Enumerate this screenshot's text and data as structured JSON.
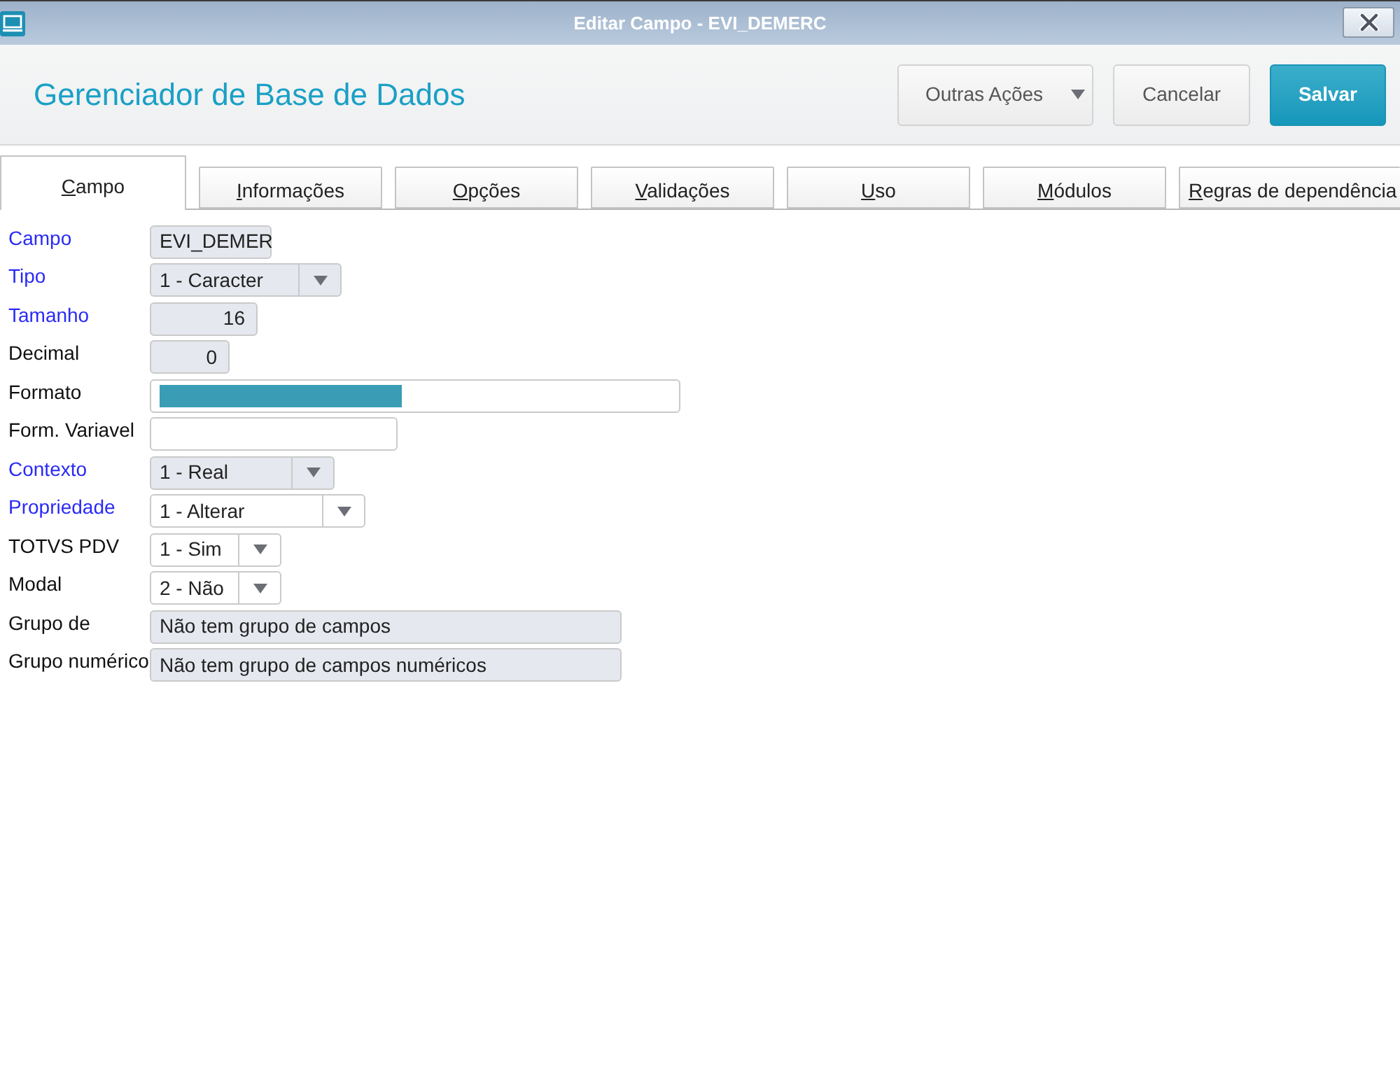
{
  "window": {
    "title": "Editar Campo - EVI_DEMERC"
  },
  "header": {
    "title": "Gerenciador de Base de Dados",
    "buttons": [
      {
        "label": "Outras Ações",
        "kind": "menu"
      },
      {
        "label": "Cancelar",
        "kind": "default"
      },
      {
        "label": "Salvar",
        "kind": "primary"
      }
    ]
  },
  "tabs": [
    {
      "label": "Campo",
      "selected": true
    },
    {
      "label": "Informações",
      "selected": false
    },
    {
      "label": "Opções",
      "selected": false
    },
    {
      "label": "Validações",
      "selected": false
    },
    {
      "label": "Uso",
      "selected": false
    },
    {
      "label": "Módulos",
      "selected": false
    },
    {
      "label": "Regras de dependência",
      "selected": false
    }
  ],
  "fields": [
    {
      "label": "Campo",
      "required": true,
      "kind": "text",
      "value": "EVI_DEMER",
      "disabled": true,
      "text_selected": false
    },
    {
      "label": "Tipo",
      "required": true,
      "kind": "select",
      "value": "1 - Caracter",
      "disabled": true,
      "text_selected": false
    },
    {
      "label": "Tamanho",
      "required": true,
      "kind": "number",
      "value": "16",
      "disabled": true,
      "text_selected": false
    },
    {
      "label": "Decimal",
      "required": false,
      "kind": "number",
      "value": "0",
      "disabled": true,
      "text_selected": false
    },
    {
      "label": "Formato",
      "required": false,
      "kind": "text",
      "disabled": false,
      "text_selected": true
    },
    {
      "label": "Form. Variavel",
      "required": false,
      "kind": "text",
      "disabled": false,
      "text_selected": false
    },
    {
      "label": "Contexto",
      "required": true,
      "kind": "select",
      "value": "1 - Real",
      "disabled": true,
      "text_selected": false
    },
    {
      "label": "Propriedade",
      "required": true,
      "kind": "select",
      "value": "1 - Alterar",
      "disabled": false,
      "text_selected": false
    },
    {
      "label": "TOTVS PDV",
      "required": false,
      "kind": "select",
      "value": "1 - Sim",
      "disabled": false,
      "text_selected": false
    },
    {
      "label": "Modal",
      "required": false,
      "kind": "select",
      "value": "2 - Não",
      "disabled": false,
      "text_selected": false
    },
    {
      "label": "Grupo de",
      "required": false,
      "kind": "text",
      "value": "Não tem grupo de campos",
      "disabled": true,
      "text_selected": false
    },
    {
      "label": "Grupo numérico",
      "required": false,
      "kind": "text",
      "value": "Não tem grupo de campos numéricos",
      "disabled": true,
      "text_selected": false
    }
  ]
}
